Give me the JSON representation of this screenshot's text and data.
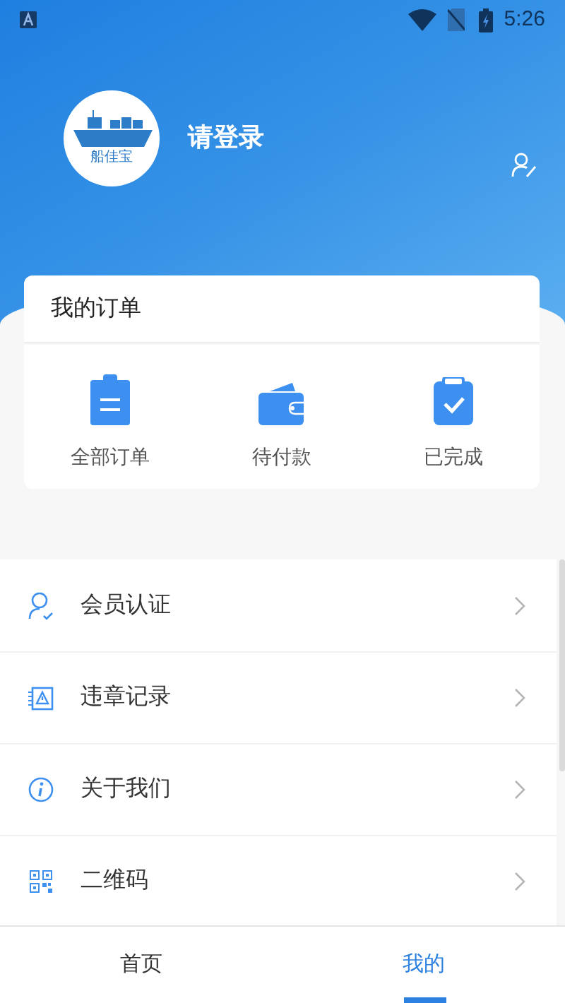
{
  "status_bar": {
    "time": "5:26"
  },
  "profile": {
    "logo_text": "船佳宝",
    "login_prompt": "请登录"
  },
  "orders": {
    "title": "我的订单",
    "items": [
      {
        "kind": "all",
        "label": "全部订单"
      },
      {
        "kind": "pending",
        "label": "待付款"
      },
      {
        "kind": "done",
        "label": "已完成"
      }
    ]
  },
  "menu": [
    {
      "kind": "member",
      "label": "会员认证"
    },
    {
      "kind": "violation",
      "label": "违章记录"
    },
    {
      "kind": "about",
      "label": "关于我们"
    },
    {
      "kind": "qrcode",
      "label": "二维码"
    }
  ],
  "tabs": [
    {
      "label": "首页",
      "selected": false
    },
    {
      "label": "我的",
      "selected": true
    }
  ]
}
